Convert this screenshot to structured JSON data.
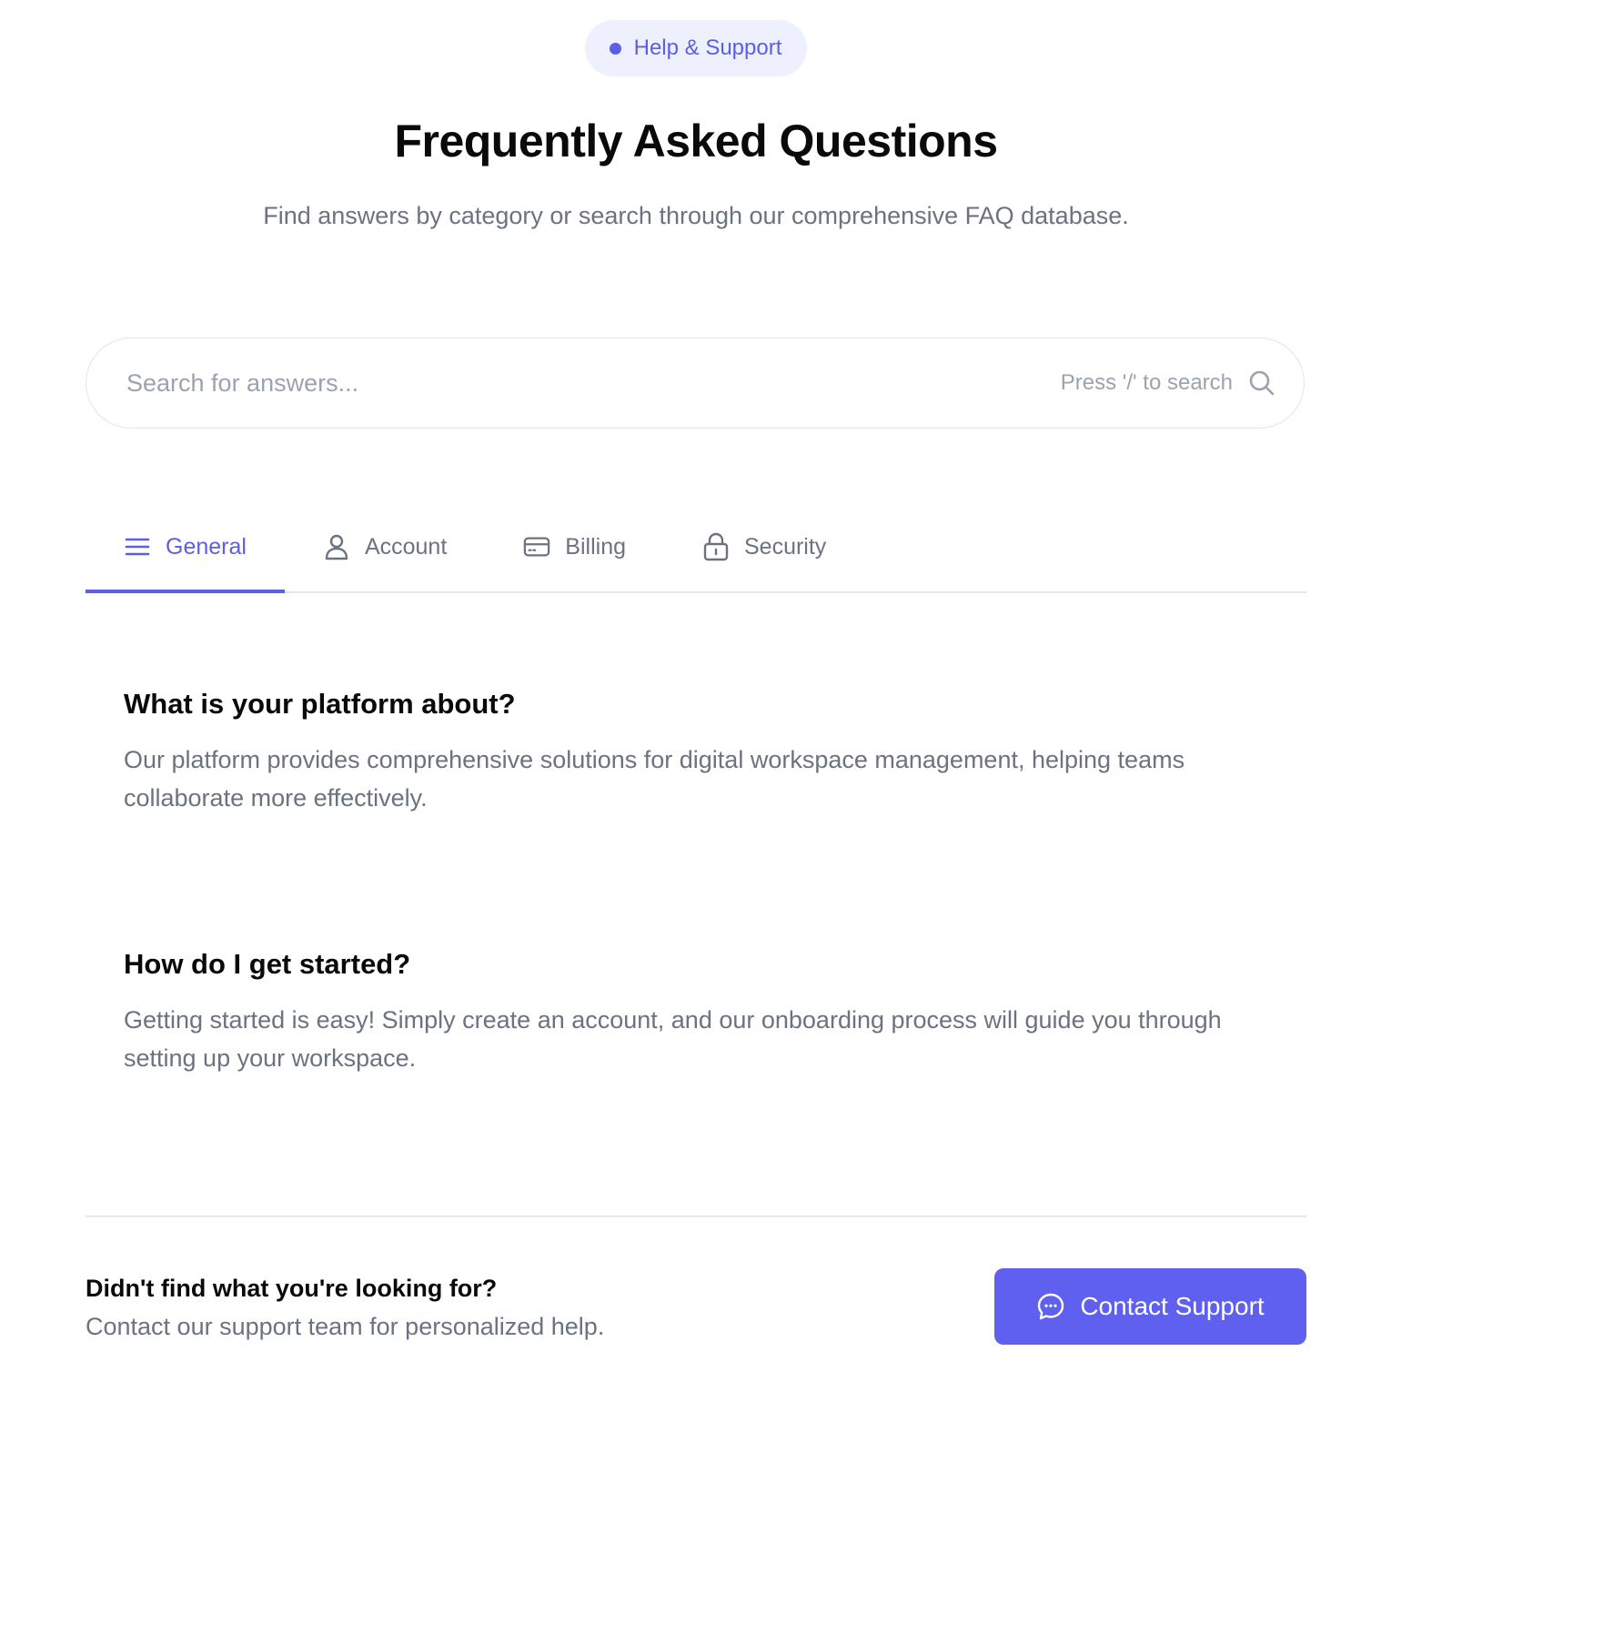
{
  "badge": {
    "label": "Help & Support"
  },
  "header": {
    "title": "Frequently Asked Questions",
    "subtitle": "Find answers by category or search through our comprehensive FAQ database."
  },
  "search": {
    "placeholder": "Search for answers...",
    "value": "",
    "hint": "Press '/' to search",
    "icon": "search-icon"
  },
  "tabs": [
    {
      "label": "General",
      "icon": "menu-icon",
      "active": true
    },
    {
      "label": "Account",
      "icon": "user-icon",
      "active": false
    },
    {
      "label": "Billing",
      "icon": "credit-card-icon",
      "active": false
    },
    {
      "label": "Security",
      "icon": "lock-icon",
      "active": false
    }
  ],
  "faqs": [
    {
      "question": "What is your platform about?",
      "answer": "Our platform provides comprehensive solutions for digital workspace management, helping teams collaborate more effectively."
    },
    {
      "question": "How do I get started?",
      "answer": "Getting started is easy! Simply create an account, and our onboarding process will guide you through setting up your workspace."
    }
  ],
  "footer": {
    "title": "Didn't find what you're looking for?",
    "text": "Contact our support team for personalized help.",
    "button_label": "Contact Support",
    "button_icon": "chat-bubble-icon"
  },
  "colors": {
    "accent": "#5b5fe6",
    "badge_bg": "#eef0fd",
    "muted_text": "#6b7280",
    "placeholder_text": "#9ca3af",
    "border": "#e5e7eb",
    "button_bg": "#5f5ff0"
  }
}
